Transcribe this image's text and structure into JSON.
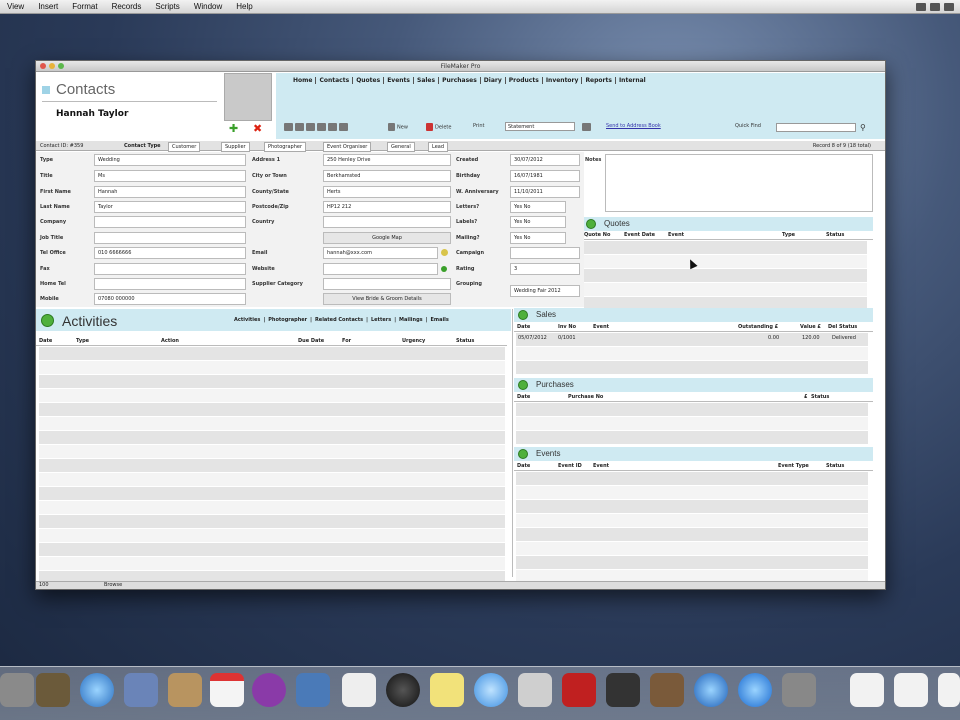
{
  "menubar": {
    "items": [
      "View",
      "Insert",
      "Format",
      "Records",
      "Scripts",
      "Window",
      "Help"
    ]
  },
  "window": {
    "title": "FileMaker Pro"
  },
  "header": {
    "title": "Contacts",
    "contact_name": "Hannah Taylor",
    "nav": [
      "Home",
      "Contacts",
      "Quotes",
      "Events",
      "Sales",
      "Purchases",
      "Diary",
      "Products",
      "Inventory",
      "Reports",
      "Internal"
    ],
    "toolbar": {
      "new": "New",
      "delete": "Delete",
      "print_label": "Print",
      "print_value": "Statement",
      "address_book": "Send to Address Book",
      "quick_find": "Quick Find"
    }
  },
  "strip": {
    "contact_id": "Contact ID: #359",
    "contact_type_label": "Contact Type",
    "types": [
      "Customer",
      "Supplier",
      "Photographer",
      "Event Organiser",
      "General",
      "Lead"
    ],
    "record_info": "Record 8 of 9 (18 total)"
  },
  "fields": {
    "col1": [
      {
        "label": "Type",
        "value": "Wedding"
      },
      {
        "label": "Title",
        "value": "Ms"
      },
      {
        "label": "First Name",
        "value": "Hannah"
      },
      {
        "label": "Last Name",
        "value": "Taylor"
      },
      {
        "label": "Company",
        "value": ""
      },
      {
        "label": "Job Title",
        "value": ""
      },
      {
        "label": "Tel Office",
        "value": "010 6666666"
      },
      {
        "label": "Fax",
        "value": ""
      },
      {
        "label": "Home Tel",
        "value": ""
      },
      {
        "label": "Mobile",
        "value": "07080 000000"
      }
    ],
    "col2": [
      {
        "label": "Address 1",
        "value": "250 Henley Drive"
      },
      {
        "label": "City or Town",
        "value": "Berkhamsted"
      },
      {
        "label": "County/State",
        "value": "Herts"
      },
      {
        "label": "Postcode/Zip",
        "value": "HP12 212"
      },
      {
        "label": "Country",
        "value": ""
      }
    ],
    "google_map": "Google Map",
    "col2b": [
      {
        "label": "Email",
        "value": "hannah@xxx.com"
      },
      {
        "label": "Website",
        "value": ""
      },
      {
        "label": "Supplier Category",
        "value": ""
      }
    ],
    "bride_groom": "View Bride & Groom Details",
    "col3": [
      {
        "label": "Created",
        "value": "30/07/2012"
      },
      {
        "label": "Birthday",
        "value": "16/07/1981"
      },
      {
        "label": "W. Anniversary",
        "value": "11/10/2011"
      },
      {
        "label": "Letters?",
        "value": "Yes   No"
      },
      {
        "label": "Labels?",
        "value": "Yes   No"
      },
      {
        "label": "Mailing?",
        "value": "Yes   No"
      },
      {
        "label": "Campaign",
        "value": ""
      },
      {
        "label": "Rating",
        "value": "3"
      },
      {
        "label": "Grouping",
        "value": "Wedding Fair 2012"
      }
    ],
    "notes_label": "Notes"
  },
  "activities": {
    "title": "Activities",
    "links": [
      "Activities",
      "Photographer",
      "Related Contacts",
      "Letters",
      "Mailings",
      "Emails"
    ],
    "columns": [
      "Date",
      "Type",
      "Action",
      "Due Date",
      "For",
      "Urgency",
      "Status"
    ]
  },
  "quotes": {
    "title": "Quotes",
    "columns": [
      "Quote No",
      "Event Date",
      "Event",
      "Type",
      "Status"
    ]
  },
  "sales": {
    "title": "Sales",
    "columns": [
      "Date",
      "Inv No",
      "Event",
      "Outstanding £",
      "Value £",
      "Del Status"
    ],
    "rows": [
      [
        "05/07/2012",
        "0/1001",
        "",
        "0.00",
        "120.00",
        "Delivered"
      ]
    ]
  },
  "purchases": {
    "title": "Purchases",
    "columns": [
      "Date",
      "Purchase No",
      "£",
      "Status"
    ]
  },
  "events": {
    "title": "Events",
    "columns": [
      "Date",
      "Event ID",
      "Event",
      "Event Type",
      "Status"
    ]
  },
  "statusbar": {
    "zoom": "100",
    "mode": "Browse"
  },
  "colors": {
    "accent": "#cfeaf2",
    "green": "#4fb03c"
  }
}
